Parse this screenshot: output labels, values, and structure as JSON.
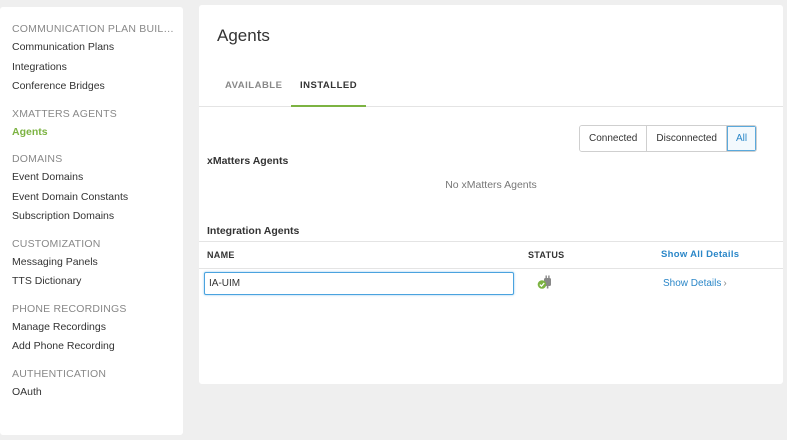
{
  "sidebar": {
    "sections": [
      {
        "header": "COMMUNICATION PLAN BUILDER",
        "items": [
          "Communication Plans",
          "Integrations",
          "Conference Bridges"
        ]
      },
      {
        "header": "XMATTERS AGENTS",
        "items": [
          "Agents"
        ]
      },
      {
        "header": "DOMAINS",
        "items": [
          "Event Domains",
          "Event Domain Constants",
          "Subscription Domains"
        ]
      },
      {
        "header": "CUSTOMIZATION",
        "items": [
          "Messaging Panels",
          "TTS Dictionary"
        ]
      },
      {
        "header": "PHONE RECORDINGS",
        "items": [
          "Manage Recordings",
          "Add Phone Recording"
        ]
      },
      {
        "header": "AUTHENTICATION",
        "items": [
          "OAuth"
        ]
      }
    ],
    "active_item": "Agents"
  },
  "main": {
    "title": "Agents",
    "tabs": [
      "AVAILABLE",
      "INSTALLED"
    ],
    "active_tab": "INSTALLED",
    "filters": [
      "Connected",
      "Disconnected",
      "All"
    ],
    "active_filter": "All",
    "xmatters_agents": {
      "heading": "xMatters Agents",
      "empty_message": "No xMatters Agents"
    },
    "integration_agents": {
      "heading": "Integration Agents",
      "columns": {
        "name": "NAME",
        "status": "STATUS",
        "show_all": "Show All Details"
      },
      "rows": [
        {
          "name": "IA-UIM",
          "status_icon": "plug-connected-icon",
          "details_label": "Show Details"
        }
      ]
    }
  },
  "colors": {
    "accent_green": "#7cb342",
    "link_blue": "#2b87c8",
    "page_bg": "#efefef"
  }
}
